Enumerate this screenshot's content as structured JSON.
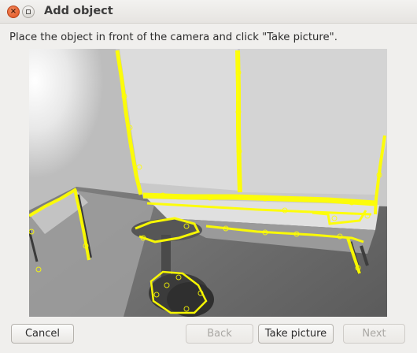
{
  "window": {
    "title": "Add object",
    "close_icon": "close-icon",
    "minimize_icon": "minimize-icon"
  },
  "instruction": "Place the object in front of the camera and click \"Take picture\".",
  "camera_preview": {
    "feature_marker_color": "#ffff00",
    "image_tone": "grayscale"
  },
  "buttons": {
    "cancel": "Cancel",
    "back": "Back",
    "take_picture": "Take picture",
    "next": "Next"
  }
}
